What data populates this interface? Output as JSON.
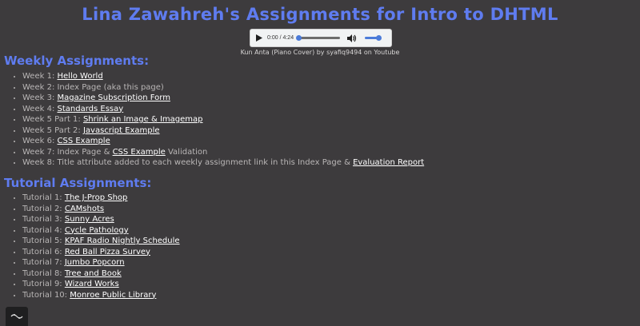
{
  "page": {
    "title": "Lina Zawahreh's Assignments for Intro to DHTML"
  },
  "audio": {
    "time": "0:00 / 4:24",
    "progress_fraction": 0.0,
    "volume_fraction": 1.0,
    "caption": "Kun Anta (Piano Cover) by syafiq9494 on Youtube",
    "accent_color": "#4b7bd9"
  },
  "weekly": {
    "heading": "Weekly Assignments:",
    "items": [
      {
        "prefix": "Week 1: ",
        "link": "Hello World",
        "suffix": ""
      },
      {
        "prefix": "Week 2: Index Page (aka this page)",
        "link": "",
        "suffix": ""
      },
      {
        "prefix": "Week 3: ",
        "link": "Magazine Subscription Form",
        "suffix": ""
      },
      {
        "prefix": "Week 4: ",
        "link": "Standards Essay",
        "suffix": ""
      },
      {
        "prefix": "Week 5 Part 1: ",
        "link": "Shrink an Image & Imagemap",
        "suffix": ""
      },
      {
        "prefix": "Week 5 Part 2: ",
        "link": "Javascript Example",
        "suffix": ""
      },
      {
        "prefix": "Week 6: ",
        "link": "CSS Example",
        "suffix": ""
      },
      {
        "prefix": "Week 7: Index Page & ",
        "link": "CSS Example",
        "suffix": " Validation"
      },
      {
        "prefix": "Week 8: Title attribute added to each weekly assignment link in this Index Page & ",
        "link": "Evaluation Report",
        "suffix": ""
      }
    ]
  },
  "tutorial": {
    "heading": "Tutorial Assignments:",
    "items": [
      {
        "prefix": "Tutorial 1: ",
        "link": "The J-Prop Shop"
      },
      {
        "prefix": "Tutorial 2: ",
        "link": "CAMshots"
      },
      {
        "prefix": "Tutorial 3: ",
        "link": "Sunny Acres"
      },
      {
        "prefix": "Tutorial 4: ",
        "link": "Cycle Pathology"
      },
      {
        "prefix": "Tutorial 5: ",
        "link": "KPAF Radio Nightly Schedule"
      },
      {
        "prefix": "Tutorial 6: ",
        "link": "Red Ball Pizza Survey"
      },
      {
        "prefix": "Tutorial 7: ",
        "link": "Jumbo Popcorn"
      },
      {
        "prefix": "Tutorial 8: ",
        "link": "Tree and Book"
      },
      {
        "prefix": "Tutorial 9: ",
        "link": "Wizard Works"
      },
      {
        "prefix": "Tutorial 10: ",
        "link": "Monroe Public Library"
      }
    ]
  },
  "colors": {
    "background": "#3d3b3d",
    "heading": "#5f7cf0",
    "text": "#b9b6b6",
    "link": "#ffffff"
  },
  "icons": {
    "play": "play-icon",
    "volume": "volume-icon",
    "corner": "ghost-icon"
  }
}
